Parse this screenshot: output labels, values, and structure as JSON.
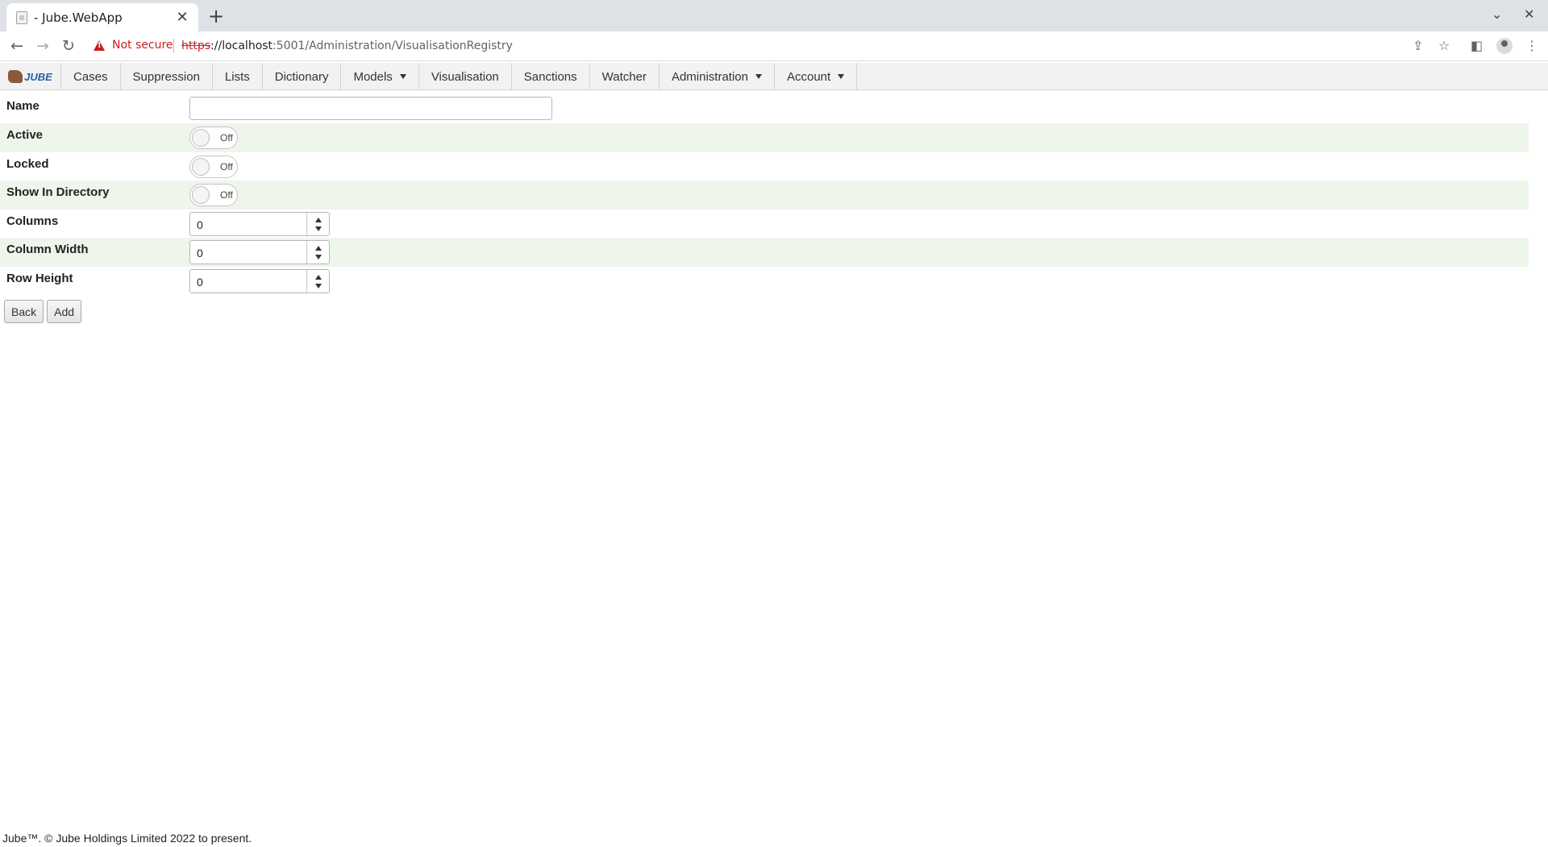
{
  "browser": {
    "tab_title": "- Jube.WebApp",
    "tab_close": "✕",
    "new_tab": "+",
    "minimize_glyph": "⌄",
    "close_glyph": "✕",
    "back_glyph": "←",
    "forward_glyph": "→",
    "reload_glyph": "↻",
    "security_label": "Not secure",
    "url_scheme": "https",
    "url_host": "://localhost",
    "url_rest": ":5001/Administration/VisualisationRegistry",
    "share_glyph": "⇪",
    "star_glyph": "☆",
    "panel_glyph": "◧",
    "menu_glyph": "⋮"
  },
  "app": {
    "logo_text": "JUBE",
    "nav": [
      {
        "label": "Cases",
        "dropdown": false
      },
      {
        "label": "Suppression",
        "dropdown": false
      },
      {
        "label": "Lists",
        "dropdown": false
      },
      {
        "label": "Dictionary",
        "dropdown": false
      },
      {
        "label": "Models",
        "dropdown": true
      },
      {
        "label": "Visualisation",
        "dropdown": false
      },
      {
        "label": "Sanctions",
        "dropdown": false
      },
      {
        "label": "Watcher",
        "dropdown": false
      },
      {
        "label": "Administration",
        "dropdown": true
      },
      {
        "label": "Account",
        "dropdown": true
      }
    ]
  },
  "form": {
    "name_label": "Name",
    "name_value": "",
    "active_label": "Active",
    "active_state": "Off",
    "locked_label": "Locked",
    "locked_state": "Off",
    "show_in_directory_label": "Show In Directory",
    "show_in_directory_state": "Off",
    "columns_label": "Columns",
    "columns_value": "0",
    "column_width_label": "Column Width",
    "column_width_value": "0",
    "row_height_label": "Row Height",
    "row_height_value": "0",
    "back_label": "Back",
    "add_label": "Add"
  },
  "footer": {
    "text": "Jube™. © Jube Holdings Limited 2022 to present."
  },
  "colors": {
    "alt_row": "#eef6ec",
    "nav_bg": "#f2f2f2",
    "insecure_red": "#c5221f"
  }
}
